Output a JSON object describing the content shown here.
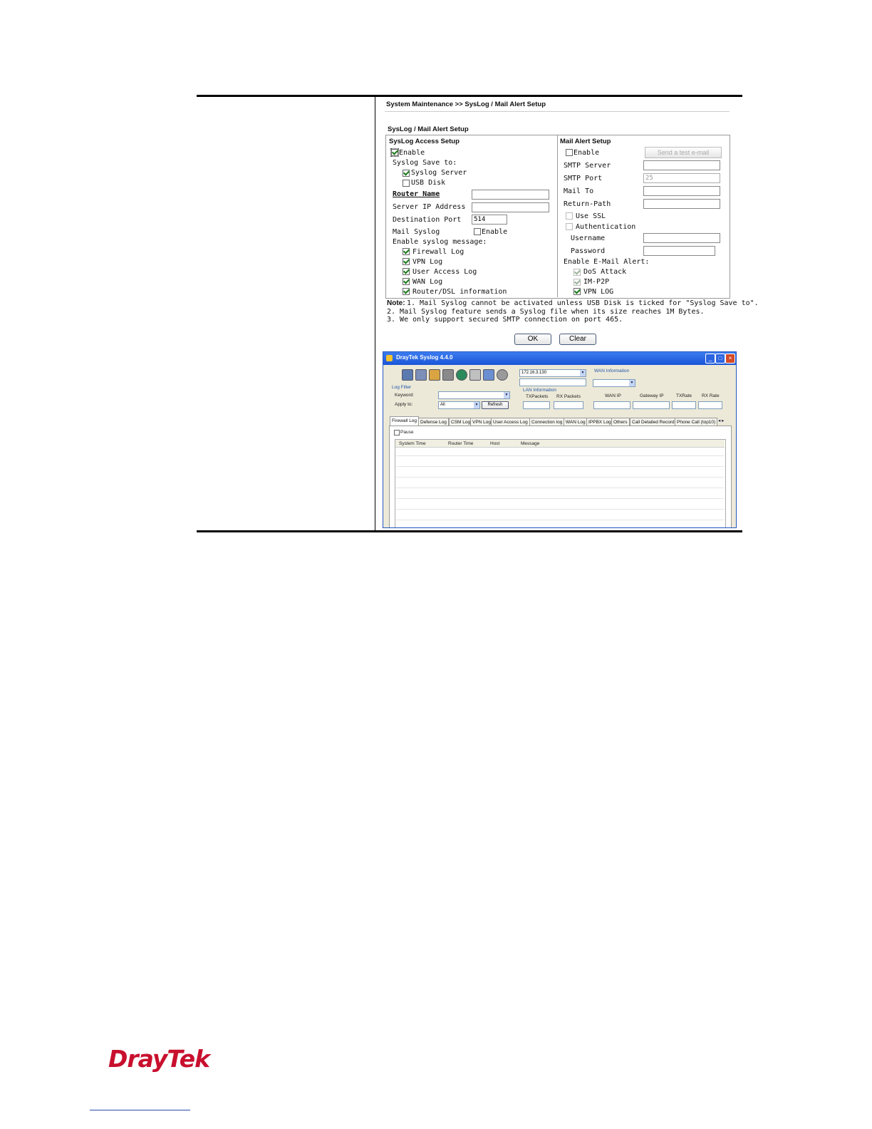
{
  "page": {
    "breadcrumb": "System Maintenance >> SysLog / Mail Alert Setup",
    "section_title": "SysLog / Mail Alert Setup"
  },
  "syslog": {
    "title": "SysLog Access Setup",
    "enable_label": "Enable",
    "enable_checked": true,
    "save_to_label": "Syslog Save to:",
    "syslog_server_label": "Syslog Server",
    "syslog_server_checked": true,
    "usb_disk_label": "USB Disk",
    "usb_disk_checked": false,
    "router_name_label": "Router Name",
    "router_name_value": "",
    "server_ip_label": "Server IP Address",
    "server_ip_value": "",
    "dest_port_label": "Destination Port",
    "dest_port_value": "514",
    "mail_syslog_label": "Mail Syslog",
    "mail_syslog_enable_label": "Enable",
    "mail_syslog_checked": false,
    "enable_msg_label": "Enable syslog message:",
    "messages": [
      {
        "label": "Firewall Log",
        "checked": true
      },
      {
        "label": "VPN Log",
        "checked": true
      },
      {
        "label": "User Access Log",
        "checked": true
      },
      {
        "label": "WAN Log",
        "checked": true
      },
      {
        "label": "Router/DSL information",
        "checked": true
      }
    ]
  },
  "mail": {
    "title": "Mail Alert Setup",
    "enable_label": "Enable",
    "enable_checked": false,
    "send_test_label": "Send a test e-mail",
    "smtp_server_label": "SMTP Server",
    "smtp_server_value": "",
    "smtp_port_label": "SMTP Port",
    "smtp_port_value": "25",
    "mail_to_label": "Mail To",
    "mail_to_value": "",
    "return_path_label": "Return-Path",
    "return_path_value": "",
    "use_ssl_label": "Use SSL",
    "auth_label": "Authentication",
    "username_label": "Username",
    "username_value": "",
    "password_label": "Password",
    "password_value": "",
    "alert_label": "Enable E-Mail Alert:",
    "alerts": [
      {
        "label": "DoS Attack",
        "checked": true
      },
      {
        "label": "IM-P2P",
        "checked": true
      },
      {
        "label": "VPN LOG",
        "checked": true
      }
    ]
  },
  "notes": {
    "line1_prefix": "Note:",
    "line1": "1. Mail Syslog cannot be activated unless USB Disk is ticked for \"Syslog Save to\".",
    "line2": "2. Mail Syslog feature sends a Syslog file when its size reaches 1M Bytes.",
    "line3": "3. We only support secured SMTP connection on port 465."
  },
  "buttons": {
    "ok": "OK",
    "clear": "Clear"
  },
  "syslog_window": {
    "title": "DrayTek Syslog 4.4.0",
    "ip_value": "172.16.3.130",
    "wan_info_label": "WAN Information",
    "lan_info_label": "LAN Information",
    "log_filter_label": "Log Filter",
    "keyword_label": "Keyword:",
    "apply_label": "Apply to:",
    "apply_value": "All",
    "refresh_label": "Refresh",
    "tx_packets": "TXPackets",
    "rx_packets": "RX Packets",
    "wan_ip": "WAN IP",
    "gateway_ip": "Gateway IP",
    "tx_rate": "TXRate",
    "rx_rate": "RX Rate",
    "tabs": [
      "Firewall Log",
      "Defense Log",
      "CSM Log",
      "VPN Log",
      "User Access Log",
      "Connection log",
      "WAN Log",
      "IPPBX Log",
      "Others",
      "Call Detailed Record",
      "Phone Call (top10)"
    ],
    "pause_label": "Pause",
    "columns": [
      "System Time",
      "Router Time",
      "Host",
      "Message"
    ]
  },
  "footer": {
    "logo": "DrayTek"
  },
  "colors": {
    "logo_red": "#c8102e",
    "title_blue": "#1a55d8",
    "check_green": "#1a7a1a"
  }
}
